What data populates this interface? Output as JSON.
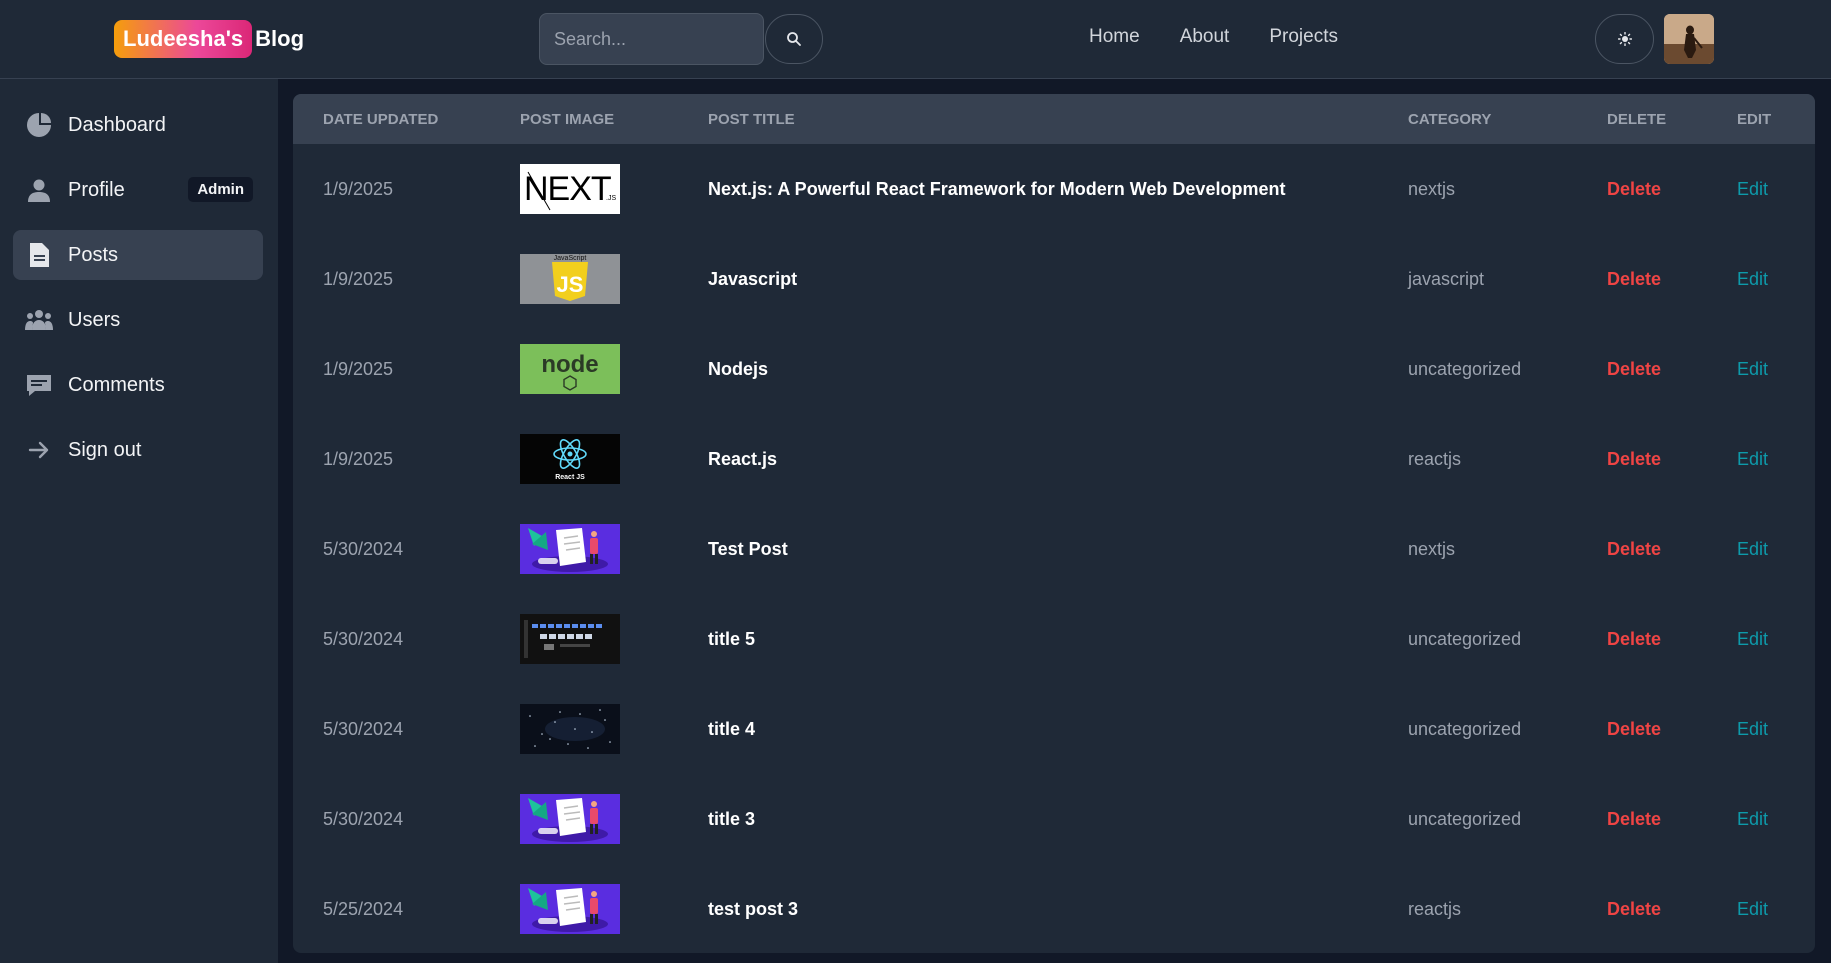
{
  "header": {
    "logo_badge": "Ludeesha's",
    "logo_rest": "Blog",
    "search_placeholder": "Search...",
    "nav": [
      "Home",
      "About",
      "Projects"
    ]
  },
  "sidebar": {
    "items": [
      {
        "label": "Dashboard",
        "icon": "pie-chart-icon"
      },
      {
        "label": "Profile",
        "icon": "user-icon",
        "badge": "Admin"
      },
      {
        "label": "Posts",
        "icon": "document-icon",
        "active": true
      },
      {
        "label": "Users",
        "icon": "users-icon"
      },
      {
        "label": "Comments",
        "icon": "comment-icon"
      },
      {
        "label": "Sign out",
        "icon": "arrow-right-icon"
      }
    ]
  },
  "table": {
    "headers": {
      "date": "Date updated",
      "image": "Post image",
      "title": "Post title",
      "category": "Category",
      "delete": "Delete",
      "edit": "Edit"
    },
    "rows": [
      {
        "date": "1/9/2025",
        "thumb": "nextjs",
        "title": "Next.js: A Powerful React Framework for Modern Web Development",
        "category": "nextjs",
        "delete": "Delete",
        "edit": "Edit"
      },
      {
        "date": "1/9/2025",
        "thumb": "javascript",
        "title": "Javascript",
        "category": "javascript",
        "delete": "Delete",
        "edit": "Edit"
      },
      {
        "date": "1/9/2025",
        "thumb": "nodejs",
        "title": "Nodejs",
        "category": "uncategorized",
        "delete": "Delete",
        "edit": "Edit"
      },
      {
        "date": "1/9/2025",
        "thumb": "reactjs",
        "title": "React.js",
        "category": "reactjs",
        "delete": "Delete",
        "edit": "Edit"
      },
      {
        "date": "5/30/2024",
        "thumb": "illustration",
        "title": "Test Post",
        "category": "nextjs",
        "delete": "Delete",
        "edit": "Edit"
      },
      {
        "date": "5/30/2024",
        "thumb": "dark-ui",
        "title": "title 5",
        "category": "uncategorized",
        "delete": "Delete",
        "edit": "Edit"
      },
      {
        "date": "5/30/2024",
        "thumb": "space",
        "title": "title 4",
        "category": "uncategorized",
        "delete": "Delete",
        "edit": "Edit"
      },
      {
        "date": "5/30/2024",
        "thumb": "illustration",
        "title": "title 3",
        "category": "uncategorized",
        "delete": "Delete",
        "edit": "Edit"
      },
      {
        "date": "5/25/2024",
        "thumb": "illustration",
        "title": "test post 3",
        "category": "reactjs",
        "delete": "Delete",
        "edit": "Edit"
      }
    ]
  },
  "thumb_text": {
    "nextjs": "NEXT",
    "nextjs_sub": ".JS",
    "javascript_top": "JavaScript",
    "javascript": "JS",
    "nodejs": "node",
    "reactjs": "React JS"
  },
  "colors": {
    "background": "#111827",
    "panel": "#1f2937",
    "header_row": "#374151",
    "delete": "#ef4444",
    "edit": "#0e9aaa"
  }
}
